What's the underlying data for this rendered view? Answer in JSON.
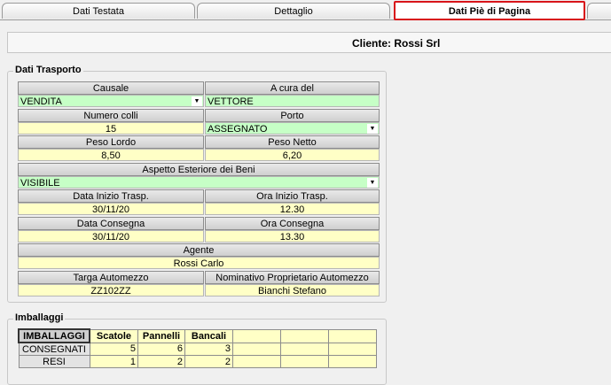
{
  "tabs": [
    "Dati Testata",
    "Dettaglio",
    "Dati Piè di Pagina"
  ],
  "client_label": "Cliente: Rossi Srl",
  "trasporto": {
    "title": "Dati Trasporto",
    "causale_label": "Causale",
    "causale_value": "VENDITA",
    "acura_label": "A cura del",
    "acura_value": "VETTORE",
    "colli_label": "Numero colli",
    "colli_value": "15",
    "porto_label": "Porto",
    "porto_value": "ASSEGNATO",
    "lordo_label": "Peso Lordo",
    "lordo_value": "8,50",
    "netto_label": "Peso Netto",
    "netto_value": "6,20",
    "aspetto_label": "Aspetto Esteriore dei Beni",
    "aspetto_value": "VISIBILE",
    "data_inizio_label": "Data Inizio Trasp.",
    "data_inizio_value": "30/11/20",
    "ora_inizio_label": "Ora Inizio Trasp.",
    "ora_inizio_value": "12.30",
    "data_consegna_label": "Data Consegna",
    "data_consegna_value": "30/11/20",
    "ora_consegna_label": "Ora Consegna",
    "ora_consegna_value": "13.30",
    "agente_label": "Agente",
    "agente_value": "Rossi Carlo",
    "targa_label": "Targa Automezzo",
    "targa_value": "ZZ102ZZ",
    "proprietario_label": "Nominativo Proprietario Automezzo",
    "proprietario_value": "Bianchi Stefano"
  },
  "imballaggi": {
    "title": "Imballaggi",
    "corner": "IMBALLAGGI",
    "columns": [
      "Scatole",
      "Pannelli",
      "Bancali"
    ],
    "rows": [
      {
        "label": "CONSEGNATI",
        "values": [
          "5",
          "6",
          "3"
        ]
      },
      {
        "label": "RESI",
        "values": [
          "1",
          "2",
          "2"
        ]
      }
    ]
  },
  "colors": {
    "header_yellow": "#ffffc6",
    "combo_green": "#c6ffc6",
    "active_tab_border": "#d8141a"
  },
  "icons": {
    "dropdown": "▼"
  }
}
